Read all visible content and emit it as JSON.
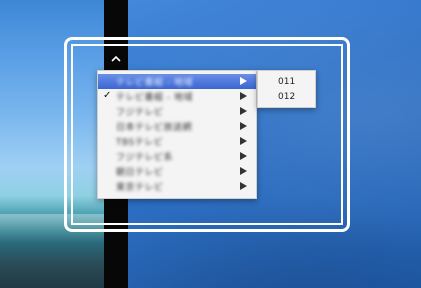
{
  "menu": {
    "items": [
      {
        "label": "テレビ番組 - 地域",
        "checked": false,
        "highlighted": true
      },
      {
        "label": "テレビ番組 - 地域",
        "checked": true,
        "highlighted": false
      },
      {
        "label": "フジテレビ",
        "checked": false,
        "highlighted": false
      },
      {
        "label": "日本テレビ放送網",
        "checked": false,
        "highlighted": false
      },
      {
        "label": "TBSテレビ",
        "checked": false,
        "highlighted": false
      },
      {
        "label": "フジテレビ系",
        "checked": false,
        "highlighted": false
      },
      {
        "label": "朝日テレビ",
        "checked": false,
        "highlighted": false
      },
      {
        "label": "東京テレビ",
        "checked": false,
        "highlighted": false
      }
    ],
    "check_glyph": "✓"
  },
  "submenu": {
    "items": [
      {
        "label": "011"
      },
      {
        "label": "012"
      }
    ]
  },
  "colors": {
    "highlight": "#3b66d2",
    "frame": "#ffffff"
  }
}
